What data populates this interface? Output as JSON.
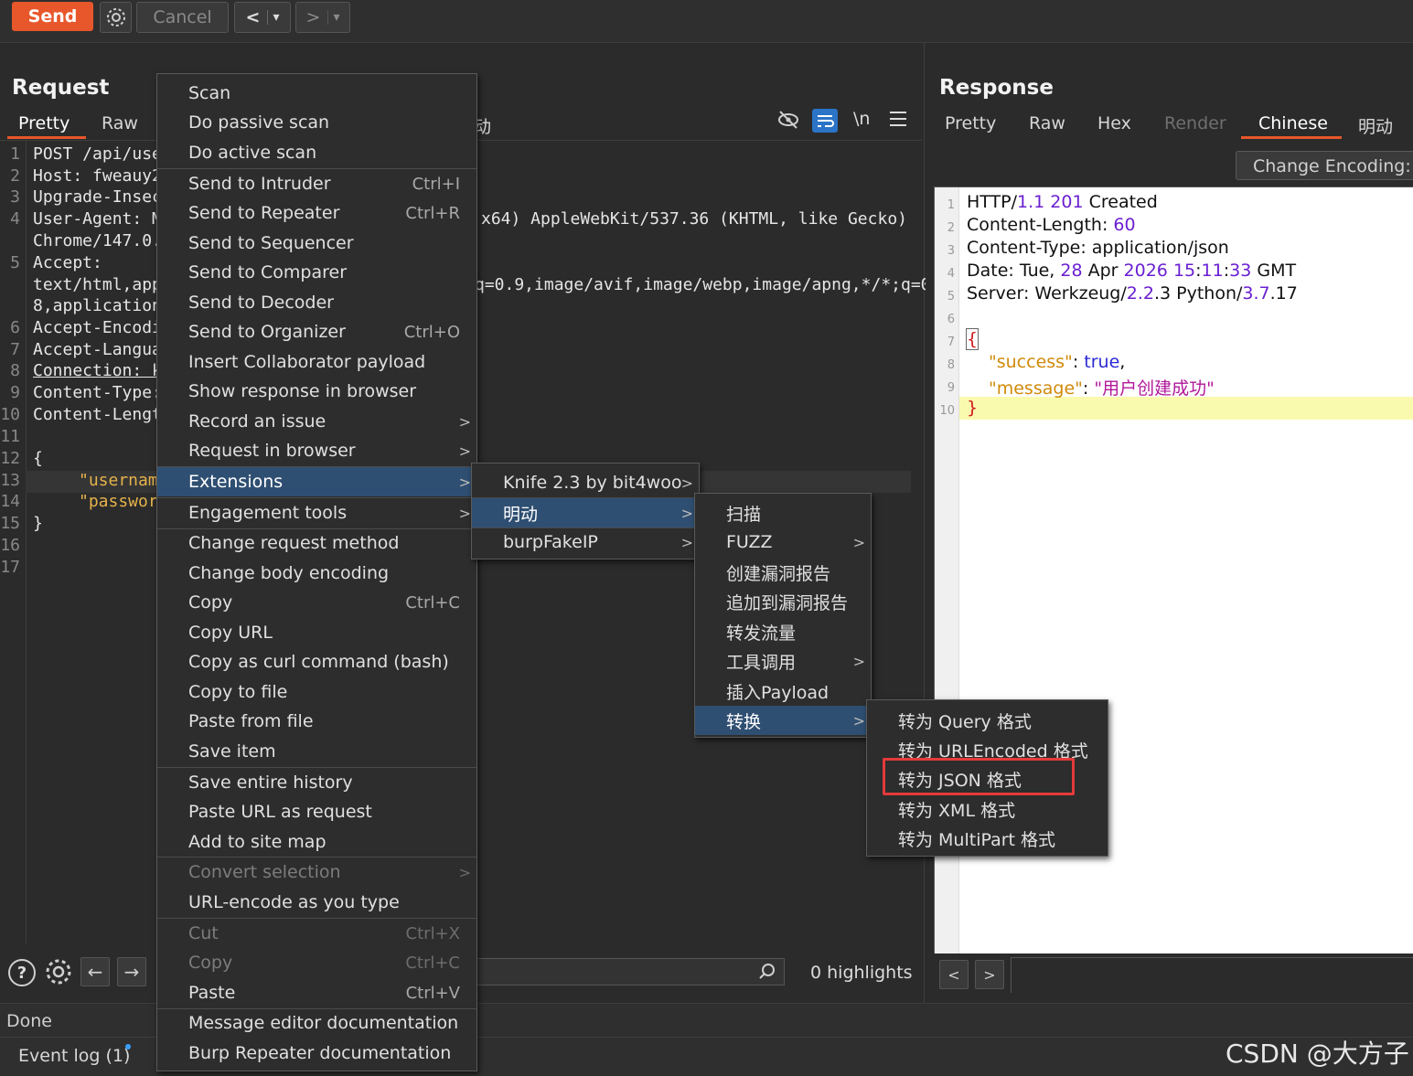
{
  "toolbar": {
    "send_label": "Send",
    "settings_icon": "gear-icon",
    "cancel_label": "Cancel",
    "back_label": "<",
    "forward_label": ">",
    "dropdown_label": "▾"
  },
  "request": {
    "title": "Request",
    "tabs": [
      "Pretty",
      "Raw"
    ],
    "active_tab": "Pretty",
    "tab_fragment": "动",
    "tool_icons": [
      "eye-slash-icon",
      "wrap-icon",
      "newline-icon",
      "menu-icon"
    ],
    "newline_label": "\\n",
    "line_numbers": [
      "1",
      "2",
      "3",
      "4",
      "5",
      "6",
      "7",
      "8",
      "9",
      "10",
      "11",
      "12",
      "13",
      "14",
      "15",
      "16",
      "17"
    ],
    "lines": {
      "l1": "POST /api/user",
      "l2": "Host: fweauy2.",
      "l3": "Upgrade-Insecu",
      "l4a": "User-Agent: Mo",
      "l4b": "Chrome/147.0.0",
      "l4_tail": "x64) AppleWebKit/537.36 (KHTML, like Gecko)",
      "l5a": "Accept:",
      "l5b": "text/html,app",
      "l5c": "8,application/",
      "l5_tail": "q=0.9,image/avif,image/webp,image/apng,*/*;q=0.",
      "l6": "Accept-Encodin",
      "l7": "Accept-Languag",
      "l8": "Connection: ke",
      "l9": "Content-Type:",
      "l10": "Content-Length",
      "l12": "{",
      "l13": "\"username",
      "l14": "\"passwor",
      "l15": "}"
    }
  },
  "response": {
    "title": "Response",
    "tabs": [
      "Pretty",
      "Raw",
      "Hex",
      "Render",
      "Chinese",
      "明动"
    ],
    "active_tab": "Chinese",
    "change_encoding_label": "Change Encoding:",
    "line_numbers": [
      "1",
      "2",
      "3",
      "4",
      "5",
      "6",
      "7",
      "8",
      "9",
      "10"
    ],
    "status": {
      "proto": "HTTP/",
      "ver": "1.1",
      "code": "201",
      "text": "Created"
    },
    "content_length": {
      "key": "Content-Length: ",
      "val": "60"
    },
    "content_type": "Content-Type: application/json",
    "date": {
      "p1": "Date: Tue, ",
      "day": "28",
      "p2": " Apr ",
      "year": "2026",
      "p3": " ",
      "hh": "15",
      "c1": ":",
      "mm": "11",
      "c2": ":",
      "ss": "33",
      "p4": " GMT"
    },
    "server": {
      "p1": "Server: Werkzeug/",
      "v1": "2.2",
      "p2": ".3 Python/",
      "v2": "3.7",
      "p3": ".17"
    },
    "json_open": "{",
    "success_key": "\"success\"",
    "success_val": "true",
    "message_key": "\"message\"",
    "message_val": "\"用户创建成功\"",
    "json_close": "}"
  },
  "context_menu": {
    "items": [
      {
        "label": "Scan"
      },
      {
        "label": "Do passive scan"
      },
      {
        "label": "Do active scan"
      },
      {
        "label": "Send to Intruder",
        "shortcut": "Ctrl+I"
      },
      {
        "label": "Send to Repeater",
        "shortcut": "Ctrl+R"
      },
      {
        "label": "Send to Sequencer"
      },
      {
        "label": "Send to Comparer"
      },
      {
        "label": "Send to Decoder"
      },
      {
        "label": "Send to Organizer",
        "shortcut": "Ctrl+O"
      },
      {
        "label": "Insert Collaborator payload"
      },
      {
        "label": "Show response in browser"
      },
      {
        "label": "Record an issue"
      },
      {
        "label": "Request in browser"
      },
      {
        "label": "Extensions"
      },
      {
        "label": "Engagement tools"
      },
      {
        "label": "Change request method"
      },
      {
        "label": "Change body encoding"
      },
      {
        "label": "Copy",
        "shortcut": "Ctrl+C"
      },
      {
        "label": "Copy URL"
      },
      {
        "label": "Copy as curl command (bash)"
      },
      {
        "label": "Copy to file"
      },
      {
        "label": "Paste from file"
      },
      {
        "label": "Save item"
      },
      {
        "label": "Save entire history"
      },
      {
        "label": "Paste URL as request"
      },
      {
        "label": "Add to site map"
      },
      {
        "label": "Convert selection"
      },
      {
        "label": "URL-encode as you type"
      },
      {
        "label": "Cut",
        "shortcut": "Ctrl+X"
      },
      {
        "label": "Copy",
        "shortcut": "Ctrl+C"
      },
      {
        "label": "Paste",
        "shortcut": "Ctrl+V"
      },
      {
        "label": "Message editor documentation"
      },
      {
        "label": "Burp Repeater documentation"
      }
    ],
    "submenu_arrow": ">"
  },
  "extensions_menu": {
    "items": [
      {
        "label": "Knife 2.3 by bit4woo"
      },
      {
        "label": "明动"
      },
      {
        "label": "burpFakeIP"
      }
    ]
  },
  "mingdong_menu": {
    "items": [
      {
        "label": "扫描"
      },
      {
        "label": "FUZZ"
      },
      {
        "label": "创建漏洞报告"
      },
      {
        "label": "追加到漏洞报告"
      },
      {
        "label": "转发流量"
      },
      {
        "label": "工具调用"
      },
      {
        "label": "插入Payload"
      },
      {
        "label": "转换"
      }
    ]
  },
  "convert_menu": {
    "items": [
      {
        "label": "转为 Query 格式"
      },
      {
        "label": "转为 URLEncoded 格式"
      },
      {
        "label": "转为 JSON 格式"
      },
      {
        "label": "转为 XML 格式"
      },
      {
        "label": "转为 MultiPart 格式"
      }
    ]
  },
  "bottom": {
    "help_label": "?",
    "search_icon": "search-icon",
    "highlights": "0 highlights",
    "resp_prev": "<",
    "resp_next": ">"
  },
  "status": {
    "done": "Done",
    "event_log": "Event log (1)",
    "watermark": "CSDN @大方子"
  },
  "colors": {
    "accent": "#e8572b",
    "menu_selected": "#2f4f72",
    "highlight_box": "#e53a3a"
  }
}
